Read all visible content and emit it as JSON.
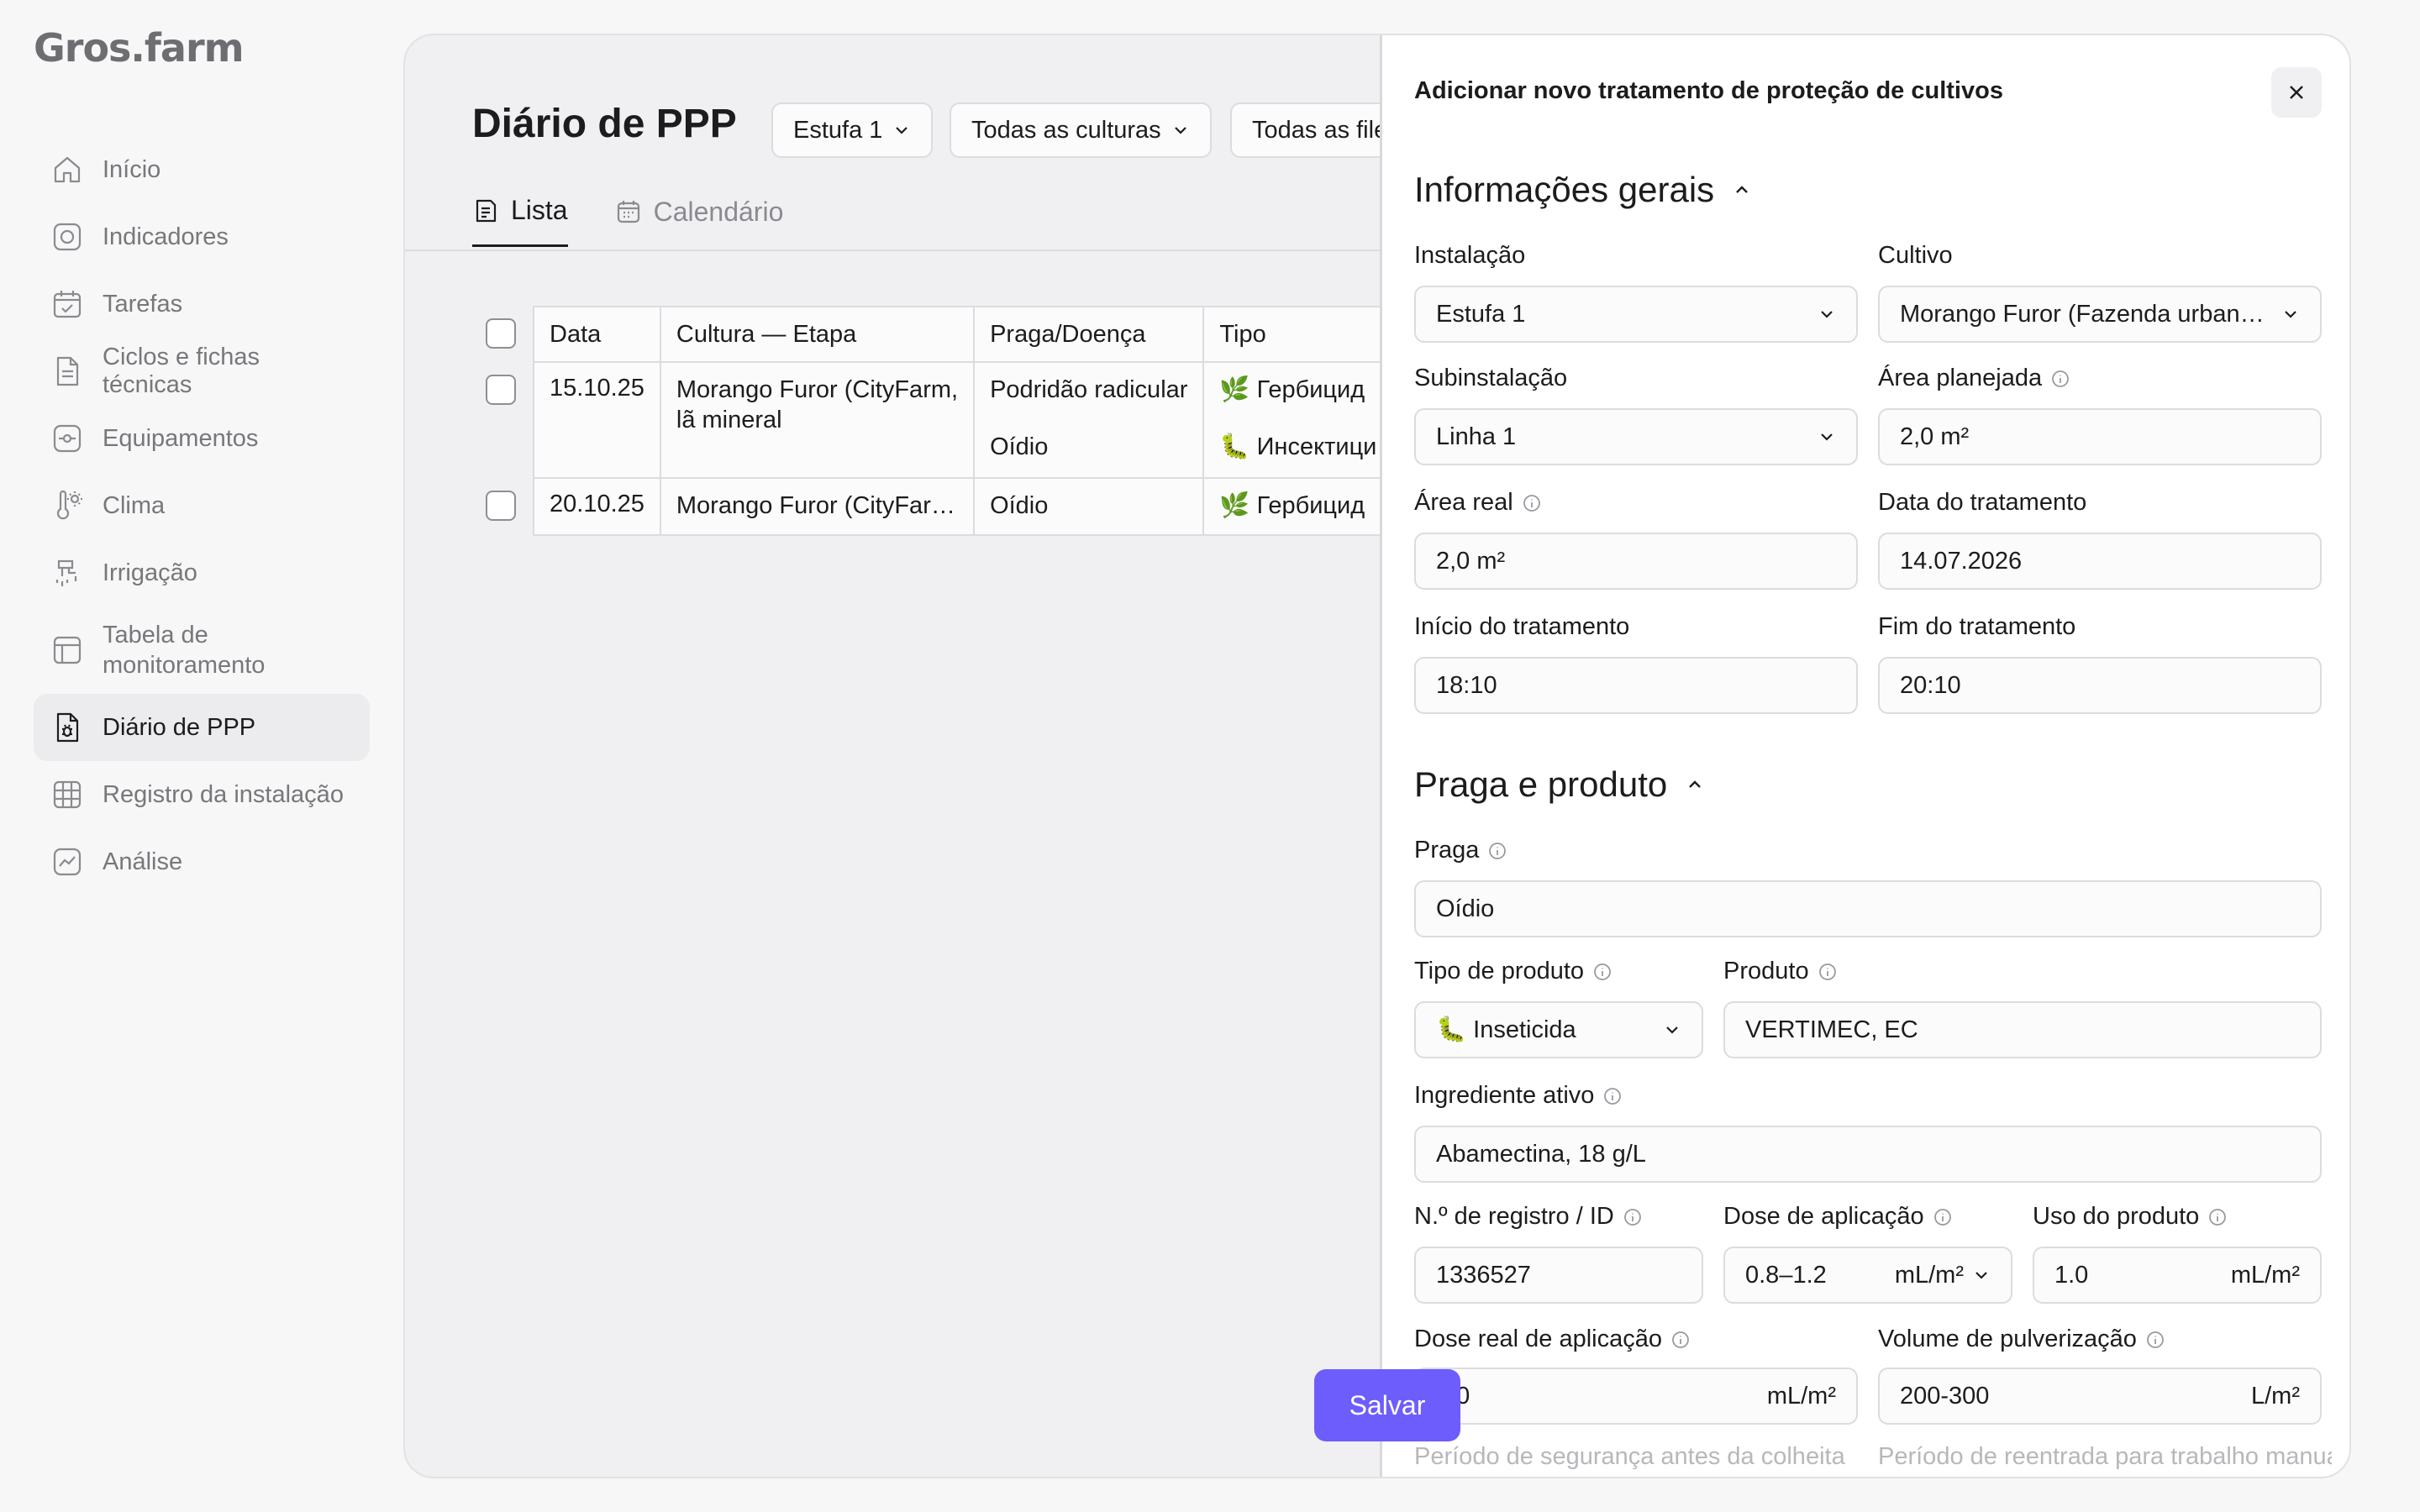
{
  "app": {
    "logo": "Gros.farm"
  },
  "sidebar": {
    "items": [
      {
        "label": "Início",
        "icon": "home-icon"
      },
      {
        "label": "Indicadores",
        "icon": "gauge-icon"
      },
      {
        "label": "Tarefas",
        "icon": "calendar-check-icon"
      },
      {
        "label": "Ciclos e fichas técnicas",
        "icon": "document-icon"
      },
      {
        "label": "Equipamentos",
        "icon": "equipment-icon"
      },
      {
        "label": "Clima",
        "icon": "thermometer-sun-icon"
      },
      {
        "label": "Irrigação",
        "icon": "irrigation-icon"
      },
      {
        "label": "Tabela de monitoramento",
        "icon": "table-icon"
      },
      {
        "label": "Diário de PPP",
        "icon": "bug-document-icon",
        "active": true
      },
      {
        "label": "Registro da instalação",
        "icon": "grid-icon"
      },
      {
        "label": "Análise",
        "icon": "chart-icon"
      }
    ]
  },
  "main": {
    "title": "Diário de PPP",
    "filters": [
      "Estufa 1",
      "Todas as culturas",
      "Todas as file"
    ],
    "tabs": [
      {
        "label": "Lista",
        "active": true
      },
      {
        "label": "Calendário",
        "active": false
      }
    ],
    "table": {
      "headers": [
        "Data",
        "Cultura — Etapa",
        "Praga/Doença",
        "Tipo"
      ],
      "rows": [
        {
          "date": "15.10.25",
          "crop_line1": "Morango Furor (CityFarm,",
          "crop_line2": "lã mineral",
          "pests": [
            "Podridão radicular",
            "Oídio"
          ],
          "types": [
            "🌿 Гербицид",
            "🐛 Инсектици"
          ]
        },
        {
          "date": "20.10.25",
          "crop_line1": "Morango Furor (CityFar…",
          "pests": [
            "Oídio"
          ],
          "types": [
            "🌿 Гербицид"
          ]
        }
      ]
    }
  },
  "drawer": {
    "title": "Adicionar novo tratamento de proteção de cultivos",
    "sections": {
      "general": "Informações gerais",
      "pest_product": "Praga e produto"
    },
    "fields": {
      "installation": {
        "label": "Instalação",
        "value": "Estufa 1"
      },
      "crop": {
        "label": "Cultivo",
        "value": "Morango Furor (Fazenda urbana..."
      },
      "sub_installation": {
        "label": "Subinstalação",
        "value": "Linha 1"
      },
      "planned_area": {
        "label": "Área planejada",
        "value": "2,0 m²"
      },
      "real_area": {
        "label": "Área real",
        "value": "2,0 m²"
      },
      "treatment_date": {
        "label": "Data do tratamento",
        "value": "14.07.2026"
      },
      "treatment_start": {
        "label": "Início do tratamento",
        "value": "18:10"
      },
      "treatment_end": {
        "label": "Fim do tratamento",
        "value": "20:10"
      },
      "pest": {
        "label": "Praga",
        "value": "Oídio"
      },
      "product_type": {
        "label": "Tipo de produto",
        "value": "🐛 Inseticida"
      },
      "product": {
        "label": "Produto",
        "value": "VERTIMEC, EC"
      },
      "active_ingredient": {
        "label": "Ingrediente ativo",
        "value": "Abamectina, 18 g/L"
      },
      "registry_id": {
        "label": "N.º de registro / ID",
        "value": "1336527"
      },
      "application_dose": {
        "label": "Dose de aplicação",
        "value": "0.8–1.2",
        "unit": "mL/m²"
      },
      "product_use": {
        "label": "Uso do produto",
        "value": "1.0",
        "unit": "mL/m²"
      },
      "real_dose": {
        "label": "Dose real de aplicação",
        "value": "1.0",
        "unit": "mL/m²"
      },
      "spray_volume": {
        "label": "Volume de pulverização",
        "value": "200-300",
        "unit": "L/m²"
      },
      "preharvest_interval": {
        "label": "Período de segurança antes da colheita"
      },
      "reentry_interval": {
        "label": "Período de reentrada para trabalho manual"
      }
    },
    "save_label": "Salvar"
  },
  "colors": {
    "accent": "#6d5dfc",
    "active_nav_bg": "#ececee",
    "panel_bg": "#f0f0f2"
  }
}
